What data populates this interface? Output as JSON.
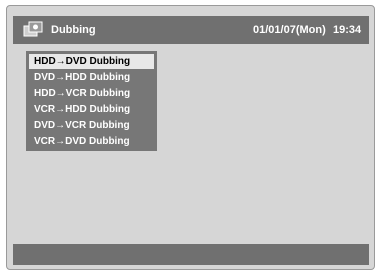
{
  "header": {
    "title": "Dubbing",
    "date": "01/01/07(Mon)",
    "time": "19:34",
    "icon": "dubbing-icon"
  },
  "menu": {
    "items": [
      {
        "label": "HDD→DVD Dubbing",
        "selected": true
      },
      {
        "label": "DVD→HDD Dubbing",
        "selected": false
      },
      {
        "label": "HDD→VCR Dubbing",
        "selected": false
      },
      {
        "label": "VCR→HDD Dubbing",
        "selected": false
      },
      {
        "label": "DVD→VCR Dubbing",
        "selected": false
      },
      {
        "label": "VCR→DVD Dubbing",
        "selected": false
      }
    ]
  },
  "colors": {
    "screen_background": "#d6d6d6",
    "bar_background": "#707070",
    "menu_background": "#777777",
    "selected_background": "#e8e8e8",
    "text_light": "#ffffff",
    "text_selected": "#000000"
  }
}
